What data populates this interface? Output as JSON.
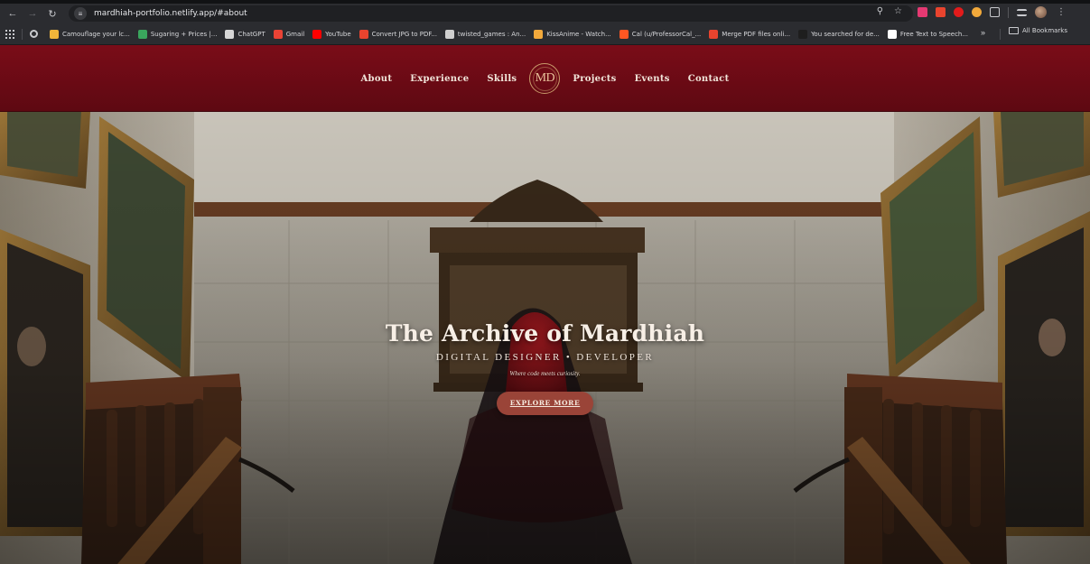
{
  "browser": {
    "url": "mardhiah-portfolio.netlify.app/#about",
    "bookmarks": [
      {
        "label": "Camouflage your lc...",
        "color": "#f0b53a"
      },
      {
        "label": "Sugaring + Prices |...",
        "color": "#3aa55d"
      },
      {
        "label": "ChatGPT",
        "color": "#d6d6d6"
      },
      {
        "label": "Gmail",
        "color": "#ea4335"
      },
      {
        "label": "YouTube",
        "color": "#ff0000"
      },
      {
        "label": "Convert JPG to PDF...",
        "color": "#e9442e"
      },
      {
        "label": "twisted_games : An...",
        "color": "#cfcfcf"
      },
      {
        "label": "KissAnime - Watch...",
        "color": "#f2a93b"
      },
      {
        "label": "Cal (u/ProfessorCal_...",
        "color": "#ff5722"
      },
      {
        "label": "Merge PDF files onli...",
        "color": "#e9442e"
      },
      {
        "label": "You searched for de...",
        "color": "#1e1e1e"
      },
      {
        "label": "Free Text to Speech...",
        "color": "#ffffff"
      }
    ],
    "bookmarks_overflow": "»",
    "all_bookmarks_label": "All Bookmarks"
  },
  "site": {
    "nav_left": [
      "About",
      "Experience",
      "Skills"
    ],
    "logo_text": "MD",
    "nav_right": [
      "Projects",
      "Events",
      "Contact"
    ],
    "accent_color": "#7a0c18"
  },
  "hero": {
    "title": "The Archive of Mardhiah",
    "subtitle": "DIGITAL DESIGNER • DEVELOPER",
    "tagline": "Where code meets curiosity.",
    "cta_label": "EXPLORE MORE"
  }
}
